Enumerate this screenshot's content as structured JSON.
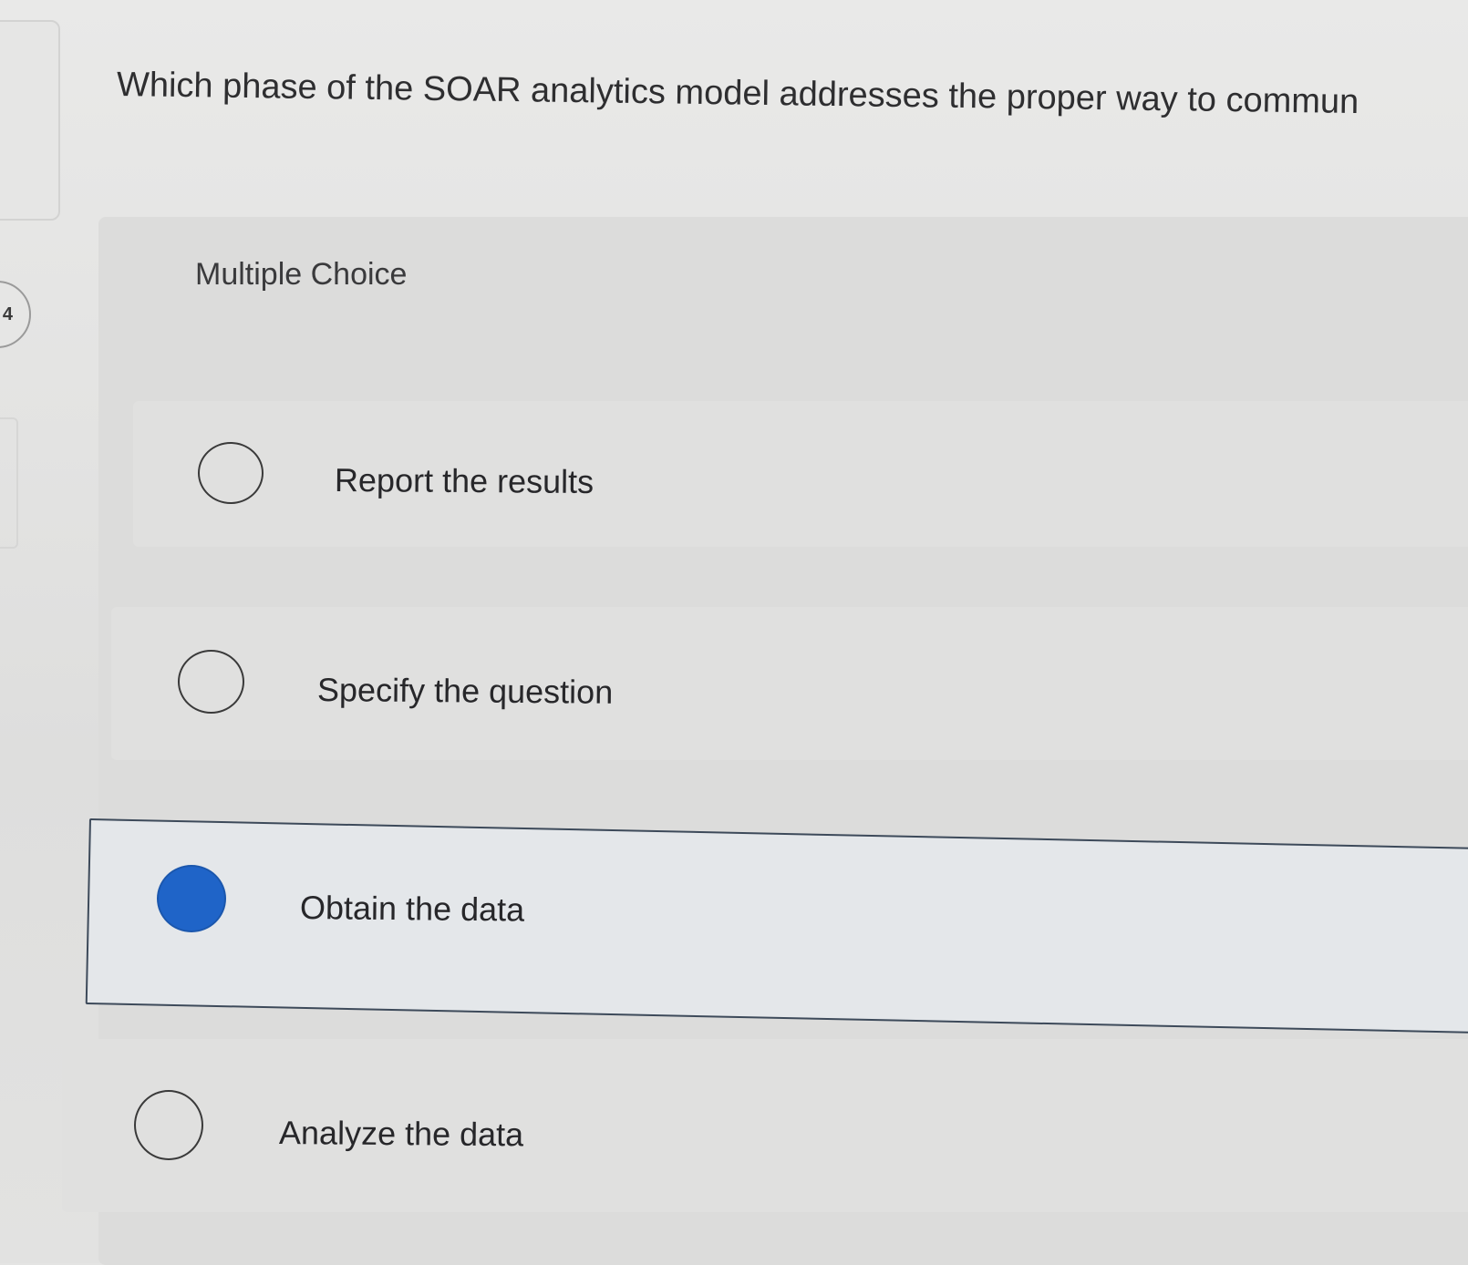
{
  "question": {
    "number": "4",
    "text": "Which phase of the SOAR analytics model addresses the proper way to commun"
  },
  "question_type": "Multiple Choice",
  "options": [
    {
      "label": "Report the results",
      "selected": false
    },
    {
      "label": "Specify the question",
      "selected": false
    },
    {
      "label": "Obtain the data",
      "selected": true
    },
    {
      "label": "Analyze the data",
      "selected": false
    }
  ],
  "colors": {
    "selected_radio": "#1f64c8",
    "selected_border": "#3d4a5a",
    "background": "#e4e4e3"
  }
}
